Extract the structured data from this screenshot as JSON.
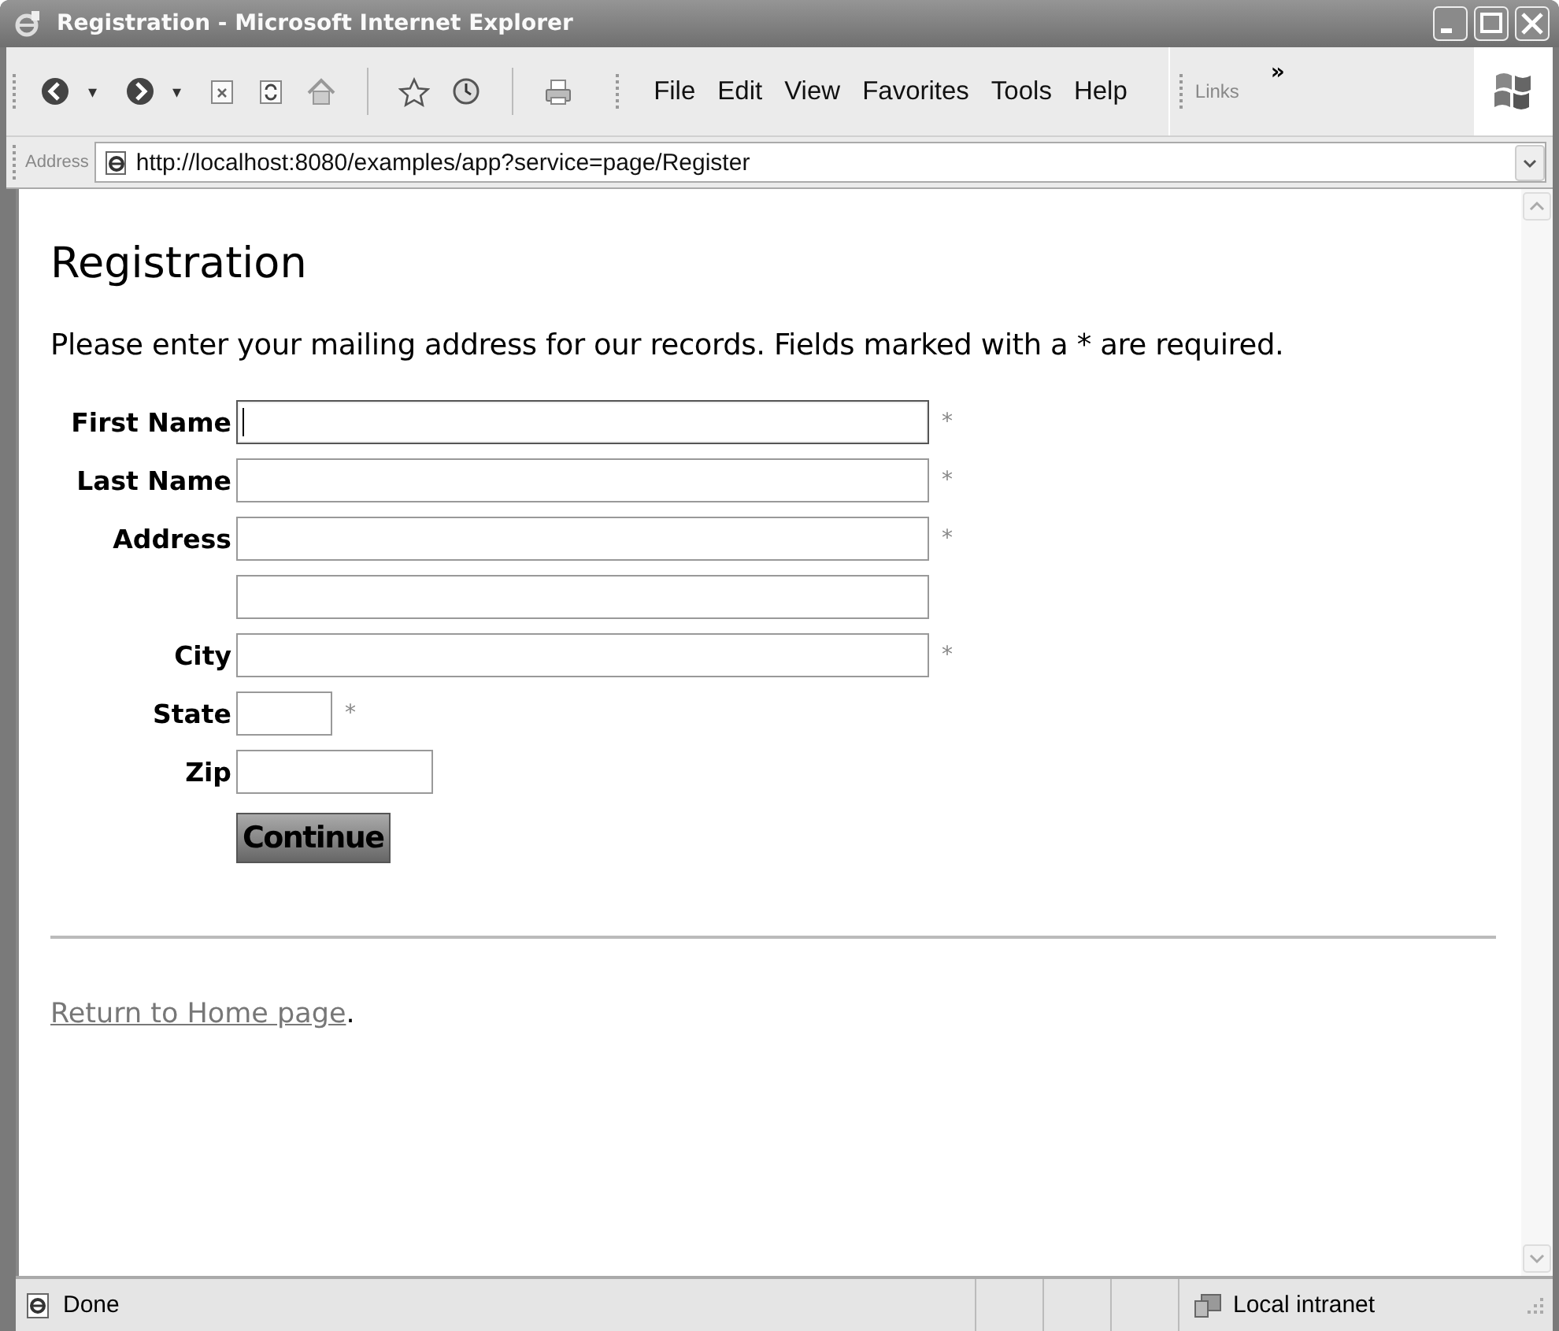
{
  "window": {
    "title": "Registration - Microsoft Internet Explorer"
  },
  "toolbar": {
    "back_dropdown": "▾",
    "forward_dropdown": "▾"
  },
  "menu": [
    {
      "label": "File"
    },
    {
      "label": "Edit"
    },
    {
      "label": "View"
    },
    {
      "label": "Favorites"
    },
    {
      "label": "Tools"
    },
    {
      "label": "Help"
    }
  ],
  "links": {
    "label": "Links",
    "chevron": "»"
  },
  "address_bar": {
    "label": "Address",
    "value": "http://localhost:8080/examples/app?service=page/Register"
  },
  "page": {
    "heading": "Registration",
    "intro": "Please enter your mailing address for our records. Fields marked with a * are required.",
    "fields": [
      {
        "label": "First Name",
        "kind": "long",
        "required": "*",
        "focused": true
      },
      {
        "label": "Last Name",
        "kind": "long",
        "required": "*",
        "focused": false
      },
      {
        "label": "Address",
        "kind": "long",
        "required": "*",
        "focused": false
      },
      {
        "kind": "long",
        "focused": false
      },
      {
        "label": "City",
        "kind": "long",
        "required": "*",
        "focused": false
      },
      {
        "label": "State",
        "kind": "short",
        "required": "*",
        "focused": false
      },
      {
        "label": "Zip",
        "kind": "medium",
        "focused": false
      }
    ],
    "submit": "Continue",
    "link": "Return to Home page",
    "link_suffix": "."
  },
  "status_bar": {
    "status": "Done",
    "zone": "Local intranet"
  }
}
